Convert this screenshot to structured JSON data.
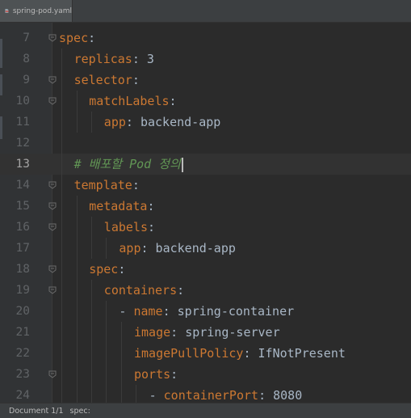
{
  "tab": {
    "label": "spring-pod.yaml",
    "icon": "yaml-file-icon"
  },
  "lines": [
    {
      "num": "7",
      "indent": 0,
      "key": "spec",
      "sep": ":",
      "value": ""
    },
    {
      "num": "8",
      "indent": 1,
      "key": "replicas",
      "sep": ":",
      "value": " 3"
    },
    {
      "num": "9",
      "indent": 1,
      "key": "selector",
      "sep": ":",
      "value": ""
    },
    {
      "num": "10",
      "indent": 2,
      "key": "matchLabels",
      "sep": ":",
      "value": ""
    },
    {
      "num": "11",
      "indent": 3,
      "key": "app",
      "sep": ":",
      "value": " backend-app"
    },
    {
      "num": "12",
      "indent": 0,
      "key": "",
      "sep": "",
      "value": ""
    },
    {
      "num": "13",
      "indent": 1,
      "comment": "# 배포할 Pod 정의"
    },
    {
      "num": "14",
      "indent": 1,
      "key": "template",
      "sep": ":",
      "value": ""
    },
    {
      "num": "15",
      "indent": 2,
      "key": "metadata",
      "sep": ":",
      "value": ""
    },
    {
      "num": "16",
      "indent": 3,
      "key": "labels",
      "sep": ":",
      "value": ""
    },
    {
      "num": "17",
      "indent": 4,
      "key": "app",
      "sep": ":",
      "value": " backend-app"
    },
    {
      "num": "18",
      "indent": 2,
      "key": "spec",
      "sep": ":",
      "value": ""
    },
    {
      "num": "19",
      "indent": 3,
      "key": "containers",
      "sep": ":",
      "value": ""
    },
    {
      "num": "20",
      "indent": 4,
      "dash": "- ",
      "key": "name",
      "sep": ":",
      "value": " spring-container"
    },
    {
      "num": "21",
      "indent": 5,
      "key": "image",
      "sep": ":",
      "value": " spring-server"
    },
    {
      "num": "22",
      "indent": 5,
      "key": "imagePullPolicy",
      "sep": ":",
      "value": " IfNotPresent"
    },
    {
      "num": "23",
      "indent": 5,
      "key": "ports",
      "sep": ":",
      "value": ""
    },
    {
      "num": "24",
      "indent": 6,
      "dash": "- ",
      "key": "containerPort",
      "sep": ":",
      "value": " 8080"
    }
  ],
  "current_line": "13",
  "status": {
    "position": "Document 1/1",
    "breadcrumb": "spec:"
  },
  "colors": {
    "key": "#cc7832",
    "value": "#a9b7c6",
    "comment": "#629755",
    "background": "#2b2b2b"
  }
}
